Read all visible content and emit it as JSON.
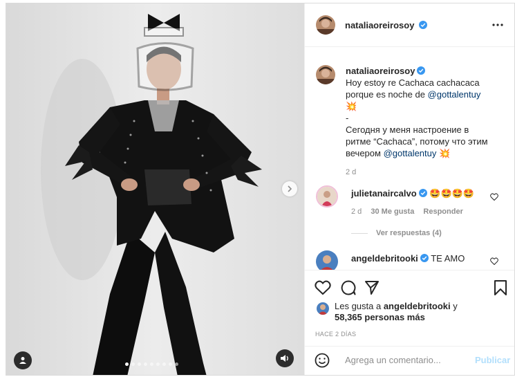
{
  "post": {
    "username": "nataliaoreirosoy",
    "more_icon": "more-options-icon"
  },
  "caption": {
    "username": "nataliaoreirosoy",
    "line1": "Hoy estoy re Cachaca cachacaca",
    "line2_prefix": "porque es noche de ",
    "mention1": "@gottalentuy",
    "emoji1": "💥",
    "dash": "-",
    "ru_line1": "Сегодня у меня настроение в",
    "ru_line2": "ритме “Cachaca”, потому что этим",
    "ru_line3_prefix": "вечером ",
    "mention2": "@gottalentuy",
    "emoji2": "💥",
    "time": "2 d"
  },
  "comments": [
    {
      "username": "julietanaircalvo",
      "text": "🤩🤩🤩🤩",
      "time": "2 d",
      "likes": "30 Me gusta",
      "reply": "Responder",
      "view_replies": "Ver respuestas (4)"
    },
    {
      "username": "angeldebritooki",
      "text": "TE AMO"
    }
  ],
  "likes": {
    "prefix": "Les gusta a ",
    "user": "angeldebritooki",
    "suffix": " y",
    "count": "58,365 personas más"
  },
  "timestamp": "HACE 2 DÍAS",
  "composer": {
    "placeholder": "Agrega un comentario...",
    "post_label": "Publicar"
  },
  "carousel": {
    "slides": 9,
    "active": 0
  },
  "colors": {
    "link": "#00376b",
    "verified": "#3897f0",
    "publish_disabled": "#b2dffc"
  }
}
